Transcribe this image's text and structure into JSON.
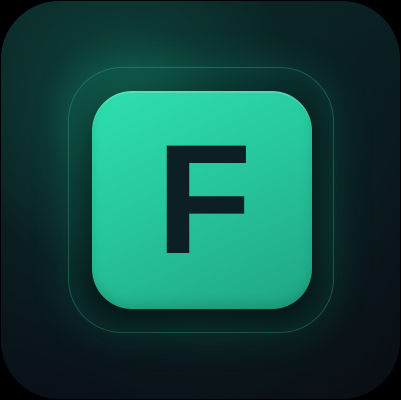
{
  "icon": {
    "letter": "F",
    "colors": {
      "key_face": "#27c79d",
      "key_highlight": "#2ee0ae",
      "letter": "#0c1f22",
      "background_dark": "#0a1018",
      "glow": "#189676"
    }
  }
}
